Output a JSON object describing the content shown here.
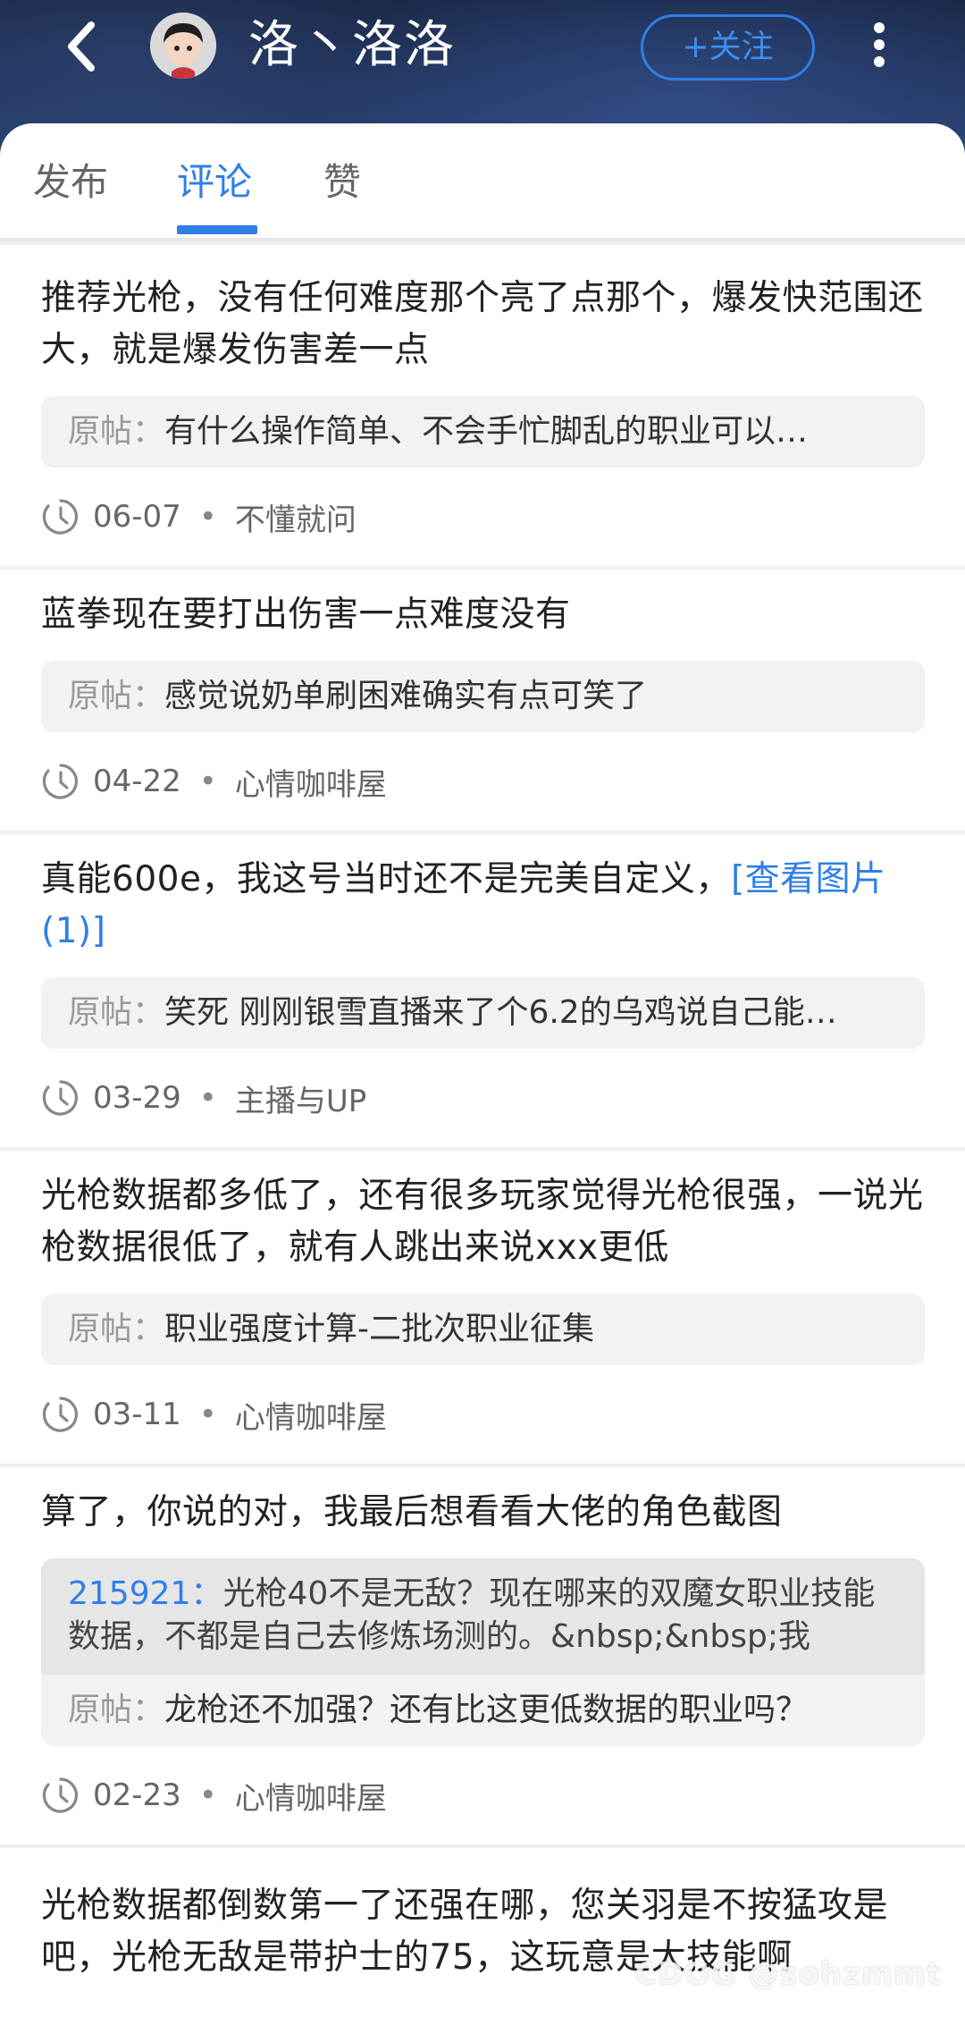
{
  "header": {
    "username": "洛丶洛洛",
    "follow_label": "+关注",
    "icons": {
      "back": "chevron-left-icon",
      "more": "more-vertical-icon",
      "avatar": "user-avatar"
    }
  },
  "tabs": [
    {
      "label": "发布",
      "active": false
    },
    {
      "label": "评论",
      "active": true
    },
    {
      "label": "赞",
      "active": false
    }
  ],
  "original_post_label": "原帖：",
  "comments": [
    {
      "text": "推荐光枪，没有任何难度那个亮了点那个，爆发快范围还大，就是爆发伤害差一点",
      "link": "",
      "reply_id": "",
      "reply_text": "",
      "original_post": "有什么操作简单、不会手忙脚乱的职业可以…",
      "date": "06-07",
      "board": "不懂就问"
    },
    {
      "text": "蓝拳现在要打出伤害一点难度没有",
      "link": "",
      "reply_id": "",
      "reply_text": "",
      "original_post": "感觉说奶单刷困难确实有点可笑了",
      "date": "04-22",
      "board": "心情咖啡屋"
    },
    {
      "text": "真能600e，我这号当时还不是完美自定义，",
      "link": "[查看图片(1)]",
      "reply_id": "",
      "reply_text": "",
      "original_post": "笑死 刚刚银雪直播来了个6.2的乌鸡说自己能…",
      "date": "03-29",
      "board": "主播与UP"
    },
    {
      "text": "光枪数据都多低了，还有很多玩家觉得光枪很强，一说光枪数据很低了，就有人跳出来说xxx更低",
      "link": "",
      "reply_id": "",
      "reply_text": "",
      "original_post": "职业强度计算-二批次职业征集",
      "date": "03-11",
      "board": "心情咖啡屋"
    },
    {
      "text": "算了，你说的对，我最后想看看大佬的角色截图",
      "link": "",
      "reply_id": "215921：",
      "reply_text": "光枪40不是无敌？现在哪来的双魔女职业技能数据，不都是自己去修炼场测的。&nbsp;&nbsp;我",
      "original_post": "龙枪还不加强？还有比这更低数据的职业吗？",
      "date": "02-23",
      "board": "心情咖啡屋"
    },
    {
      "text": "光枪数据都倒数第一了还强在哪，您关羽是不按猛攻是吧，光枪无敌是带护士的75，这玩意是大技能啊",
      "link": "",
      "reply_id": "",
      "reply_text": "",
      "original_post": "",
      "date": "",
      "board": ""
    }
  ],
  "watermark": "CDOG @sohzmmt"
}
